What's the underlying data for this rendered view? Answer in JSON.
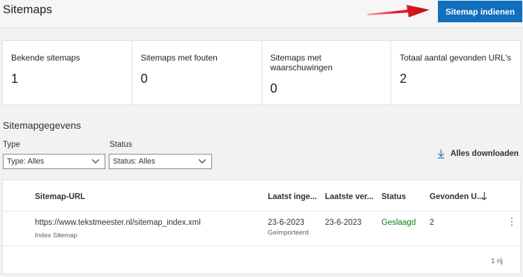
{
  "header": {
    "title": "Sitemaps",
    "submit_label": "Sitemap indienen"
  },
  "stats": [
    {
      "label": "Bekende sitemaps",
      "value": "1"
    },
    {
      "label": "Sitemaps met fouten",
      "value": "0"
    },
    {
      "label": "Sitemaps met waarschuwingen",
      "value": "0"
    },
    {
      "label": "Totaal aantal gevonden URL's",
      "value": "2"
    }
  ],
  "section": {
    "title": "Sitemapgegevens",
    "type_label": "Type",
    "type_value": "Type: Alles",
    "status_label": "Status",
    "status_value": "Status: Alles",
    "download_label": "Alles downloaden"
  },
  "table": {
    "columns": [
      "Sitemap-URL",
      "Laatst inge...",
      "Laatste ver...",
      "Status",
      "Gevonden U..."
    ],
    "rows": [
      {
        "url": "https://www.tekstmeester.nl/sitemap_index.xml",
        "type": "Index Sitemap",
        "submitted": "23-6-2023",
        "submitted_sub": "Geïmporteerd",
        "read": "23-6-2023",
        "status": "Geslaagd",
        "found": "2"
      }
    ],
    "row_count": "1 rij"
  },
  "colors": {
    "accent": "#106ebe",
    "success": "#107c10",
    "arrow": "#e81123"
  }
}
